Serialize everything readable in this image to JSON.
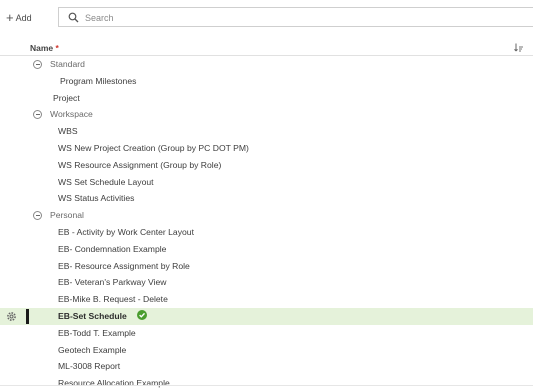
{
  "toolbar": {
    "add_label": "Add",
    "search_placeholder": "Search"
  },
  "header": {
    "name_label": "Name",
    "required_marker": "*"
  },
  "colors": {
    "active_row_bg": "#e5f2da",
    "check_green": "#4a9d2e",
    "required_red": "#d0342c"
  },
  "rows": [
    {
      "label": "Standard",
      "type": "group"
    },
    {
      "label": "Program Milestones",
      "type": "item"
    },
    {
      "label": "Project",
      "type": "item"
    },
    {
      "label": "Workspace",
      "type": "group"
    },
    {
      "label": "WBS",
      "type": "item"
    },
    {
      "label": "WS New Project Creation (Group by PC DOT PM)",
      "type": "item"
    },
    {
      "label": "WS Resource Assignment (Group by Role)",
      "type": "item"
    },
    {
      "label": "WS Set Schedule Layout",
      "type": "item"
    },
    {
      "label": "WS Status Activities",
      "type": "item"
    },
    {
      "label": "Personal",
      "type": "group"
    },
    {
      "label": "EB - Activity by Work Center Layout",
      "type": "item"
    },
    {
      "label": "EB- Condemnation Example",
      "type": "item"
    },
    {
      "label": "EB- Resource Assignment by Role",
      "type": "item"
    },
    {
      "label": "EB- Veteran's Parkway View",
      "type": "item"
    },
    {
      "label": "EB-Mike B. Request - Delete",
      "type": "item"
    },
    {
      "label": "EB-Set Schedule",
      "type": "item",
      "active": true
    },
    {
      "label": "EB-Todd T. Example",
      "type": "item"
    },
    {
      "label": "Geotech Example",
      "type": "item"
    },
    {
      "label": "ML-3008 Report",
      "type": "item"
    },
    {
      "label": "Resource Allocation Example",
      "type": "item"
    }
  ]
}
